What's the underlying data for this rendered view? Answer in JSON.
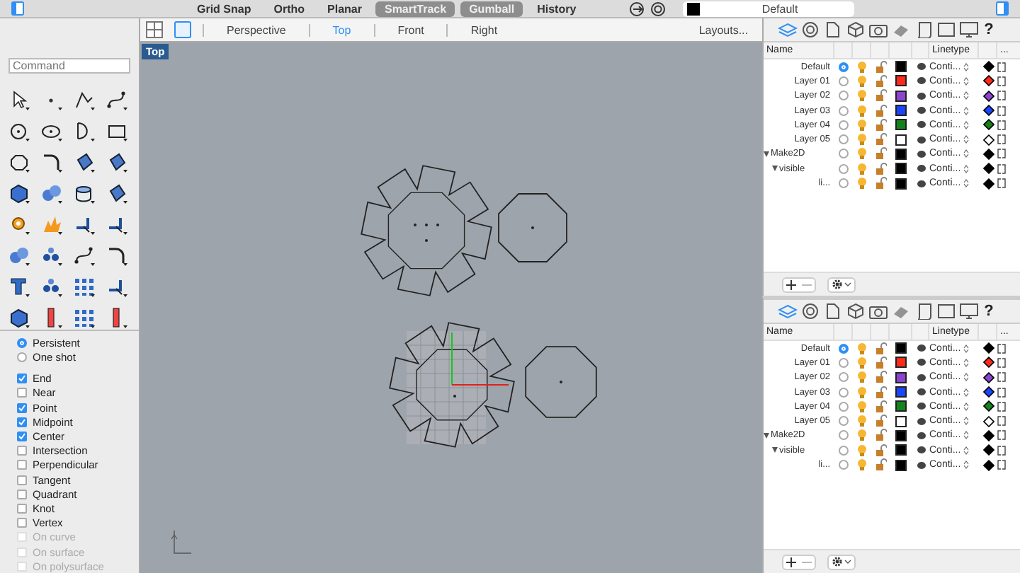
{
  "status_bar": {
    "toggles": [
      {
        "label": "Grid Snap",
        "selected": false
      },
      {
        "label": "Ortho",
        "selected": false
      },
      {
        "label": "Planar",
        "selected": false
      },
      {
        "label": "SmartTrack",
        "selected": true
      },
      {
        "label": "Gumball",
        "selected": true
      },
      {
        "label": "History",
        "selected": false
      }
    ],
    "layer": {
      "label": "Default",
      "color": "#000000"
    }
  },
  "viewport_tabs": [
    {
      "label": "Perspective",
      "selected": false
    },
    {
      "label": "Top",
      "selected": true
    },
    {
      "label": "Front",
      "selected": false
    },
    {
      "label": "Right",
      "selected": false
    }
  ],
  "layouts_button": "Layouts...",
  "viewport": {
    "title": "Top"
  },
  "command": {
    "placeholder": "Command"
  },
  "osnap": {
    "modes": [
      {
        "label": "Persistent",
        "selected": true
      },
      {
        "label": "One shot",
        "selected": false
      }
    ],
    "snaps": [
      {
        "label": "End",
        "checked": true,
        "disabled": false
      },
      {
        "label": "Near",
        "checked": false,
        "disabled": false
      },
      {
        "label": "Point",
        "checked": true,
        "disabled": false
      },
      {
        "label": "Midpoint",
        "checked": true,
        "disabled": false
      },
      {
        "label": "Center",
        "checked": true,
        "disabled": false
      },
      {
        "label": "Intersection",
        "checked": false,
        "disabled": false
      },
      {
        "label": "Perpendicular",
        "checked": false,
        "disabled": false
      },
      {
        "label": "Tangent",
        "checked": false,
        "disabled": false
      },
      {
        "label": "Quadrant",
        "checked": false,
        "disabled": false
      },
      {
        "label": "Knot",
        "checked": false,
        "disabled": false
      },
      {
        "label": "Vertex",
        "checked": false,
        "disabled": false
      },
      {
        "label": "On curve",
        "checked": false,
        "disabled": true
      },
      {
        "label": "On surface",
        "checked": false,
        "disabled": true
      },
      {
        "label": "On polysurface",
        "checked": false,
        "disabled": true
      }
    ]
  },
  "layer_panels": [
    {
      "tabs": [
        {
          "kind": "layers",
          "selected": true
        },
        {
          "kind": "target",
          "selected": false
        },
        {
          "kind": "page",
          "selected": false
        },
        {
          "kind": "cube",
          "selected": false
        },
        {
          "kind": "camera",
          "selected": false
        },
        {
          "kind": "hatch",
          "selected": false
        },
        {
          "kind": "scroll",
          "selected": false
        },
        {
          "kind": "square",
          "selected": false
        },
        {
          "kind": "monitor",
          "selected": false
        },
        {
          "kind": "help",
          "selected": false,
          "label": "?"
        }
      ],
      "columns": {
        "name": "Name",
        "linetype": "Linetype",
        "more": "..."
      },
      "layers": [
        {
          "name": "Default",
          "current": true,
          "color": "#000000",
          "linetype": "Conti..."
        },
        {
          "name": "Layer 01",
          "current": false,
          "color": "#ff2a1a",
          "linetype": "Conti..."
        },
        {
          "name": "Layer 02",
          "current": false,
          "color": "#8a44d0",
          "linetype": "Conti..."
        },
        {
          "name": "Layer 03",
          "current": false,
          "color": "#1a44ff",
          "linetype": "Conti..."
        },
        {
          "name": "Layer 04",
          "current": false,
          "color": "#12841a",
          "linetype": "Conti..."
        },
        {
          "name": "Layer 05",
          "current": false,
          "color": "#ffffff",
          "linetype": "Conti..."
        },
        {
          "name": "Make2D",
          "current": false,
          "color": "#000000",
          "linetype": "Conti...",
          "expanded": true,
          "children": [
            {
              "name": "visible",
              "current": false,
              "color": "#000000",
              "linetype": "Conti...",
              "expanded": true,
              "children": [
                {
                  "name": "li...",
                  "current": false,
                  "color": "#000000",
                  "linetype": "Conti..."
                }
              ]
            }
          ]
        }
      ]
    },
    {
      "tabs": [
        {
          "kind": "layers",
          "selected": true
        },
        {
          "kind": "target",
          "selected": false
        },
        {
          "kind": "page",
          "selected": false
        },
        {
          "kind": "cube",
          "selected": false
        },
        {
          "kind": "camera",
          "selected": false
        },
        {
          "kind": "hatch",
          "selected": false
        },
        {
          "kind": "scroll",
          "selected": false
        },
        {
          "kind": "square",
          "selected": false
        },
        {
          "kind": "monitor",
          "selected": false
        },
        {
          "kind": "help",
          "selected": false,
          "label": "?"
        }
      ],
      "columns": {
        "name": "Name",
        "linetype": "Linetype",
        "more": "..."
      },
      "layers": [
        {
          "name": "Default",
          "current": true,
          "color": "#000000",
          "linetype": "Conti..."
        },
        {
          "name": "Layer 01",
          "current": false,
          "color": "#ff2a1a",
          "linetype": "Conti..."
        },
        {
          "name": "Layer 02",
          "current": false,
          "color": "#8a44d0",
          "linetype": "Conti..."
        },
        {
          "name": "Layer 03",
          "current": false,
          "color": "#1a44ff",
          "linetype": "Conti..."
        },
        {
          "name": "Layer 04",
          "current": false,
          "color": "#12841a",
          "linetype": "Conti..."
        },
        {
          "name": "Layer 05",
          "current": false,
          "color": "#ffffff",
          "linetype": "Conti..."
        },
        {
          "name": "Make2D",
          "current": false,
          "color": "#000000",
          "linetype": "Conti...",
          "expanded": true,
          "children": [
            {
              "name": "visible",
              "current": false,
              "color": "#000000",
              "linetype": "Conti...",
              "expanded": true,
              "children": [
                {
                  "name": "li...",
                  "current": false,
                  "color": "#000000",
                  "linetype": "Conti..."
                }
              ]
            }
          ]
        }
      ]
    }
  ]
}
